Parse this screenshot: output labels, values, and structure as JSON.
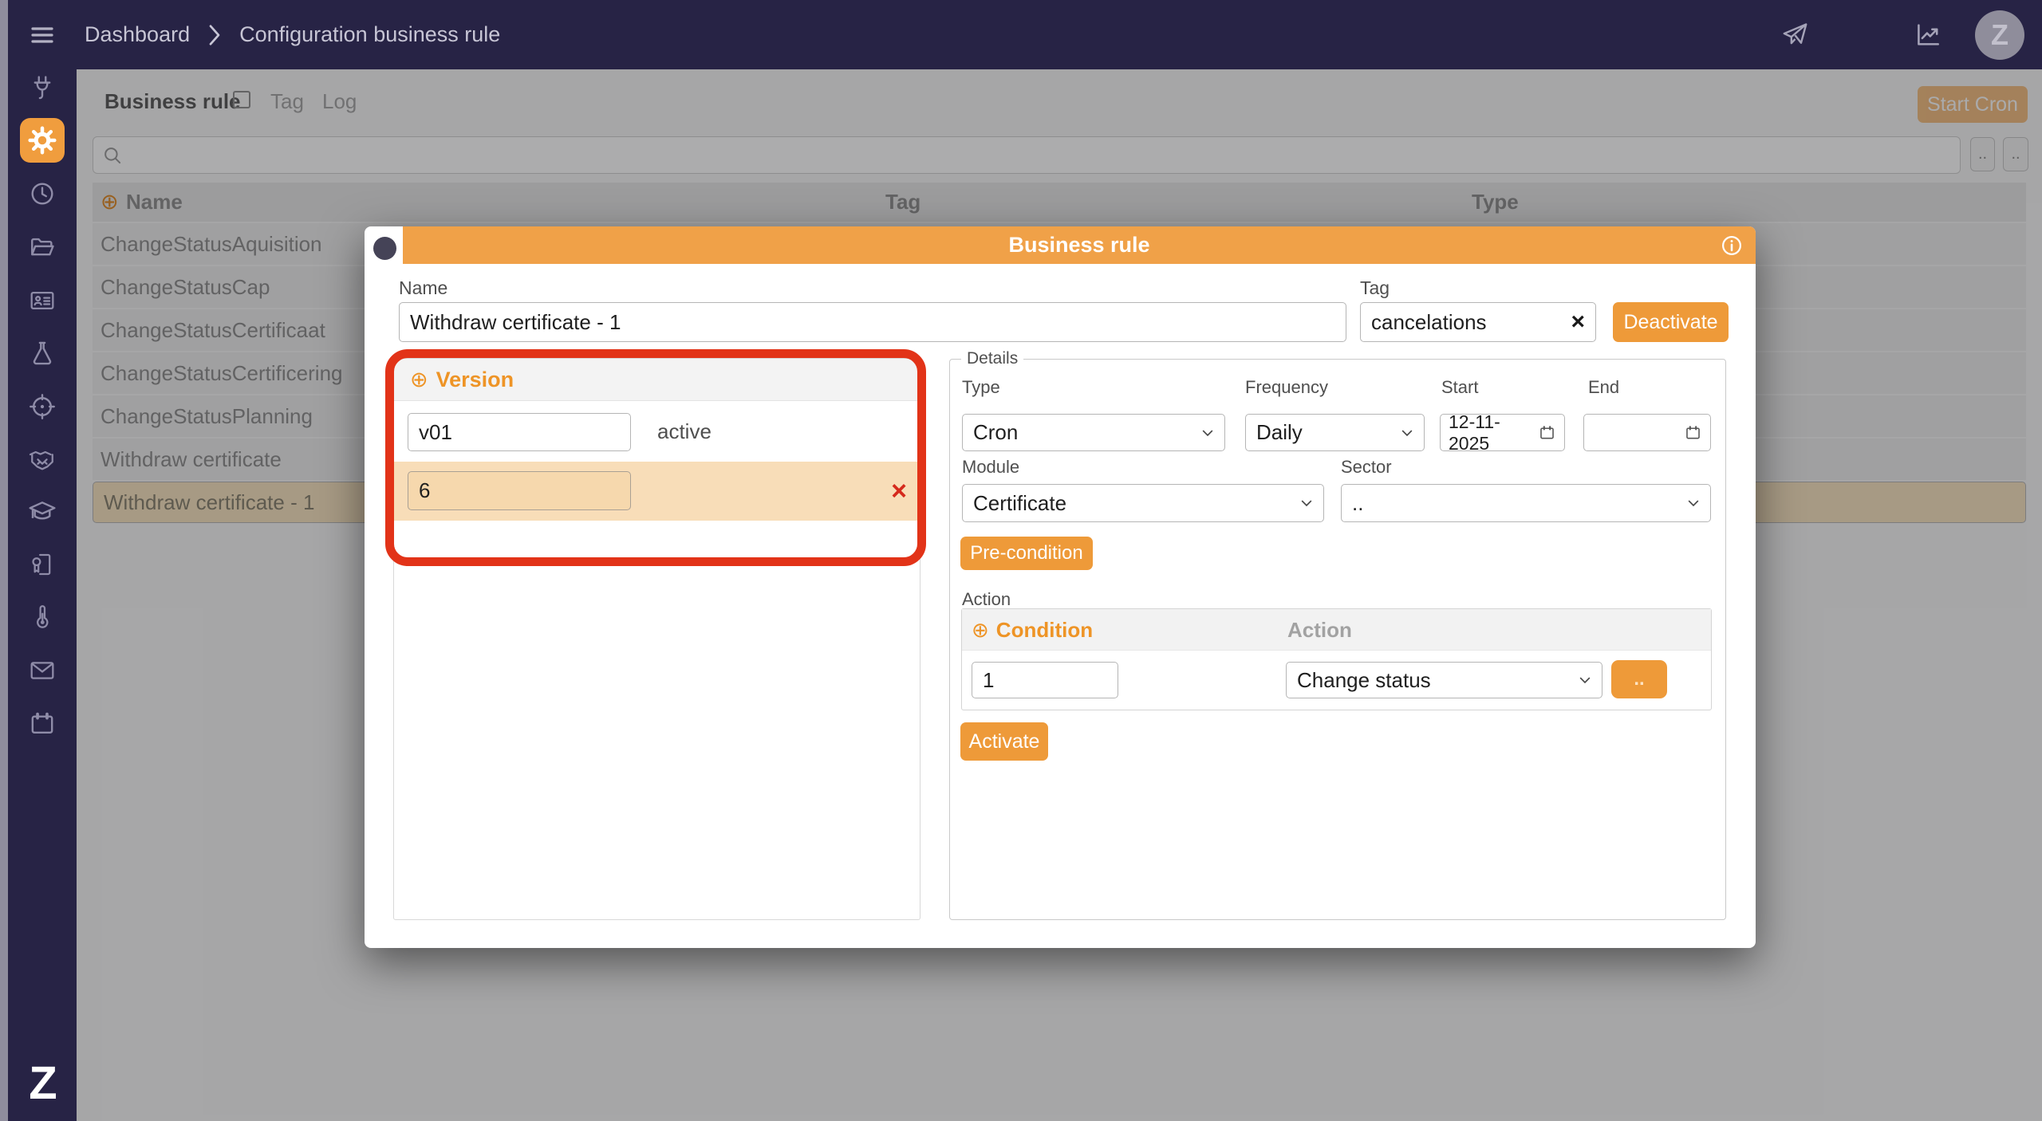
{
  "colors": {
    "navy": "#272345",
    "accent_orange": "#ee9a39",
    "header_orange": "#f0a148",
    "annotation_red": "#e23318",
    "selected_row_tan": "#f6e2c0",
    "version_row_highlight": "#f8ddb8"
  },
  "icons": {
    "plus": "⊕",
    "clear_x": "×",
    "delete_x": "×"
  },
  "topbar": {
    "breadcrumb": [
      "Dashboard",
      "Configuration business rule"
    ],
    "avatar_letter": "Z"
  },
  "sidebar": {
    "items": [
      "plug",
      "settings",
      "clock",
      "folder",
      "id-card",
      "flask",
      "target",
      "handshake",
      "graduation-cap",
      "certificate",
      "thermometer",
      "mail",
      "calendar"
    ],
    "active_item": "settings",
    "logo_text": "Z"
  },
  "tabs": {
    "business_rule": "Business rule",
    "tag": "Tag",
    "log": "Log"
  },
  "toolbar": {
    "start_cron": "Start Cron",
    "more_button": ".."
  },
  "table": {
    "headers": {
      "name": "Name",
      "tag": "Tag",
      "type": "Type"
    },
    "rows": [
      {
        "name": "ChangeStatusAquisition",
        "selected": false
      },
      {
        "name": "ChangeStatusCap",
        "selected": false
      },
      {
        "name": "ChangeStatusCertificaat",
        "selected": false
      },
      {
        "name": "ChangeStatusCertificering",
        "selected": false
      },
      {
        "name": "ChangeStatusPlanning",
        "selected": false
      },
      {
        "name": "Withdraw certificate",
        "selected": false
      },
      {
        "name": "Withdraw certificate - 1",
        "selected": true
      }
    ]
  },
  "modal": {
    "title": "Business rule",
    "name_label": "Name",
    "name_value": "Withdraw certificate - 1",
    "tag_label": "Tag",
    "tag_value": "cancelations",
    "deactivate_button": "Deactivate",
    "version": {
      "title": "Version",
      "rows": [
        {
          "value": "v01",
          "status": "active"
        },
        {
          "value": "6",
          "status": ""
        }
      ]
    },
    "details": {
      "legend": "Details",
      "type_label": "Type",
      "type_value": "Cron",
      "frequency_label": "Frequency",
      "frequency_value": "Daily",
      "start_label": "Start",
      "start_value": "12-11-2025",
      "end_label": "End",
      "end_value": "",
      "module_label": "Module",
      "module_value": "Certificate",
      "sector_label": "Sector",
      "sector_value": "..",
      "precondition_button": "Pre-condition",
      "action_label": "Action",
      "condition_header": "Condition",
      "action_header": "Action",
      "condition_value": "1",
      "action_value": "Change status",
      "more_button": "..",
      "activate_button": "Activate"
    }
  }
}
